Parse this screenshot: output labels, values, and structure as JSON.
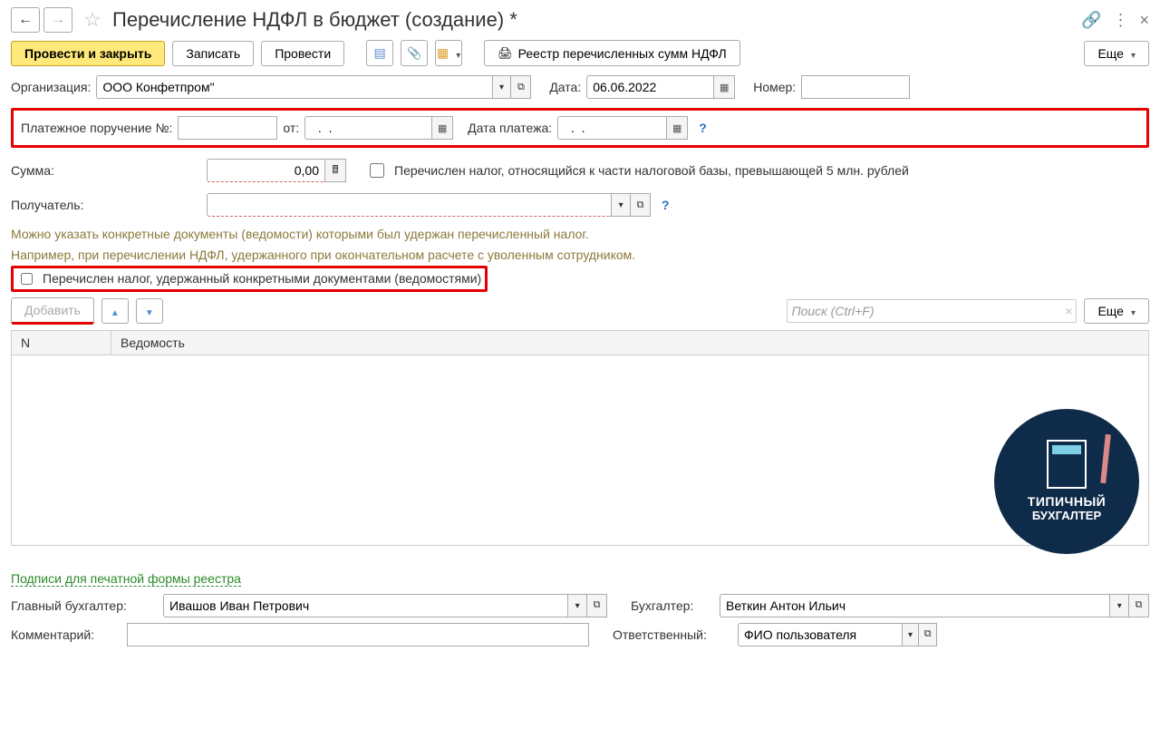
{
  "title": "Перечисление НДФЛ в бюджет (создание) *",
  "toolbar": {
    "primary": "Провести и закрыть",
    "save": "Записать",
    "post": "Провести",
    "registry": "Реестр перечисленных сумм НДФЛ",
    "more": "Еще"
  },
  "fields": {
    "org_label": "Организация:",
    "org_value": "ООО Конфетпром\"",
    "date_label": "Дата:",
    "date_value": "06.06.2022",
    "number_label": "Номер:",
    "number_value": "",
    "order_label": "Платежное поручение №:",
    "order_value": "",
    "order_from": "от:",
    "order_from_value": "  .  .",
    "pay_date_label": "Дата платежа:",
    "pay_date_value": "  .  .",
    "sum_label": "Сумма:",
    "sum_value": "0,00",
    "over5m": "Перечислен налог, относящийся к части налоговой базы, превышающей 5 млн. рублей",
    "recipient_label": "Получатель:",
    "recipient_value": ""
  },
  "help": {
    "line1": "Можно указать конкретные документы (ведомости) которыми был удержан перечисленный налог.",
    "line2": "Например, при перечислении НДФЛ, удержанного при окончательном расчете с уволенным сотрудником.",
    "docs_check": "Перечислен налог, удержанный конкретными документами (ведомостями)"
  },
  "table": {
    "add": "Добавить",
    "search_ph": "Поиск (Ctrl+F)",
    "more": "Еще",
    "col_n": "N",
    "col_v": "Ведомость"
  },
  "watermark": {
    "t1": "ТИПИЧНЫЙ",
    "t2": "БУХГАЛТЕР"
  },
  "signs": {
    "link": "Подписи для печатной формы реестра",
    "chief_label": "Главный бухгалтер:",
    "chief_value": "Ивашов Иван Петрович",
    "acc_label": "Бухгалтер:",
    "acc_value": "Веткин Антон Ильич",
    "comment_label": "Комментарий:",
    "comment_value": "",
    "resp_label": "Ответственный:",
    "resp_value": "ФИО пользователя"
  }
}
